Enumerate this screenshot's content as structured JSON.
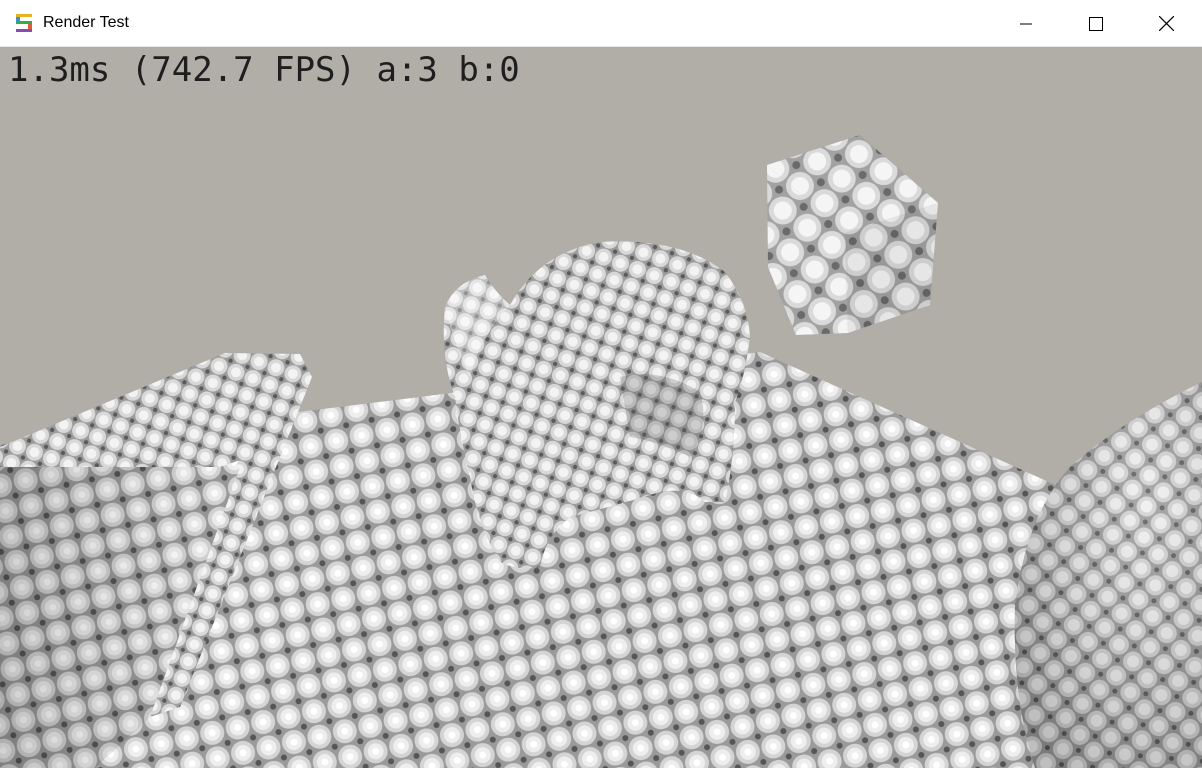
{
  "window": {
    "title": "Render Test",
    "app_icon": "sharp-s-app-icon",
    "controls": {
      "minimize": "minimize-icon",
      "maximize": "maximize-icon",
      "close": "close-icon"
    }
  },
  "hud": {
    "stats": "1.3ms (742.7 FPS) a:3 b:0"
  },
  "scene": {
    "background_color": "#b1aea8",
    "texture_color_light": "#ececec",
    "texture_color_dark": "#7a7a7a",
    "objects": [
      "floor-plane",
      "slab",
      "teapot",
      "cube",
      "sphere"
    ]
  }
}
